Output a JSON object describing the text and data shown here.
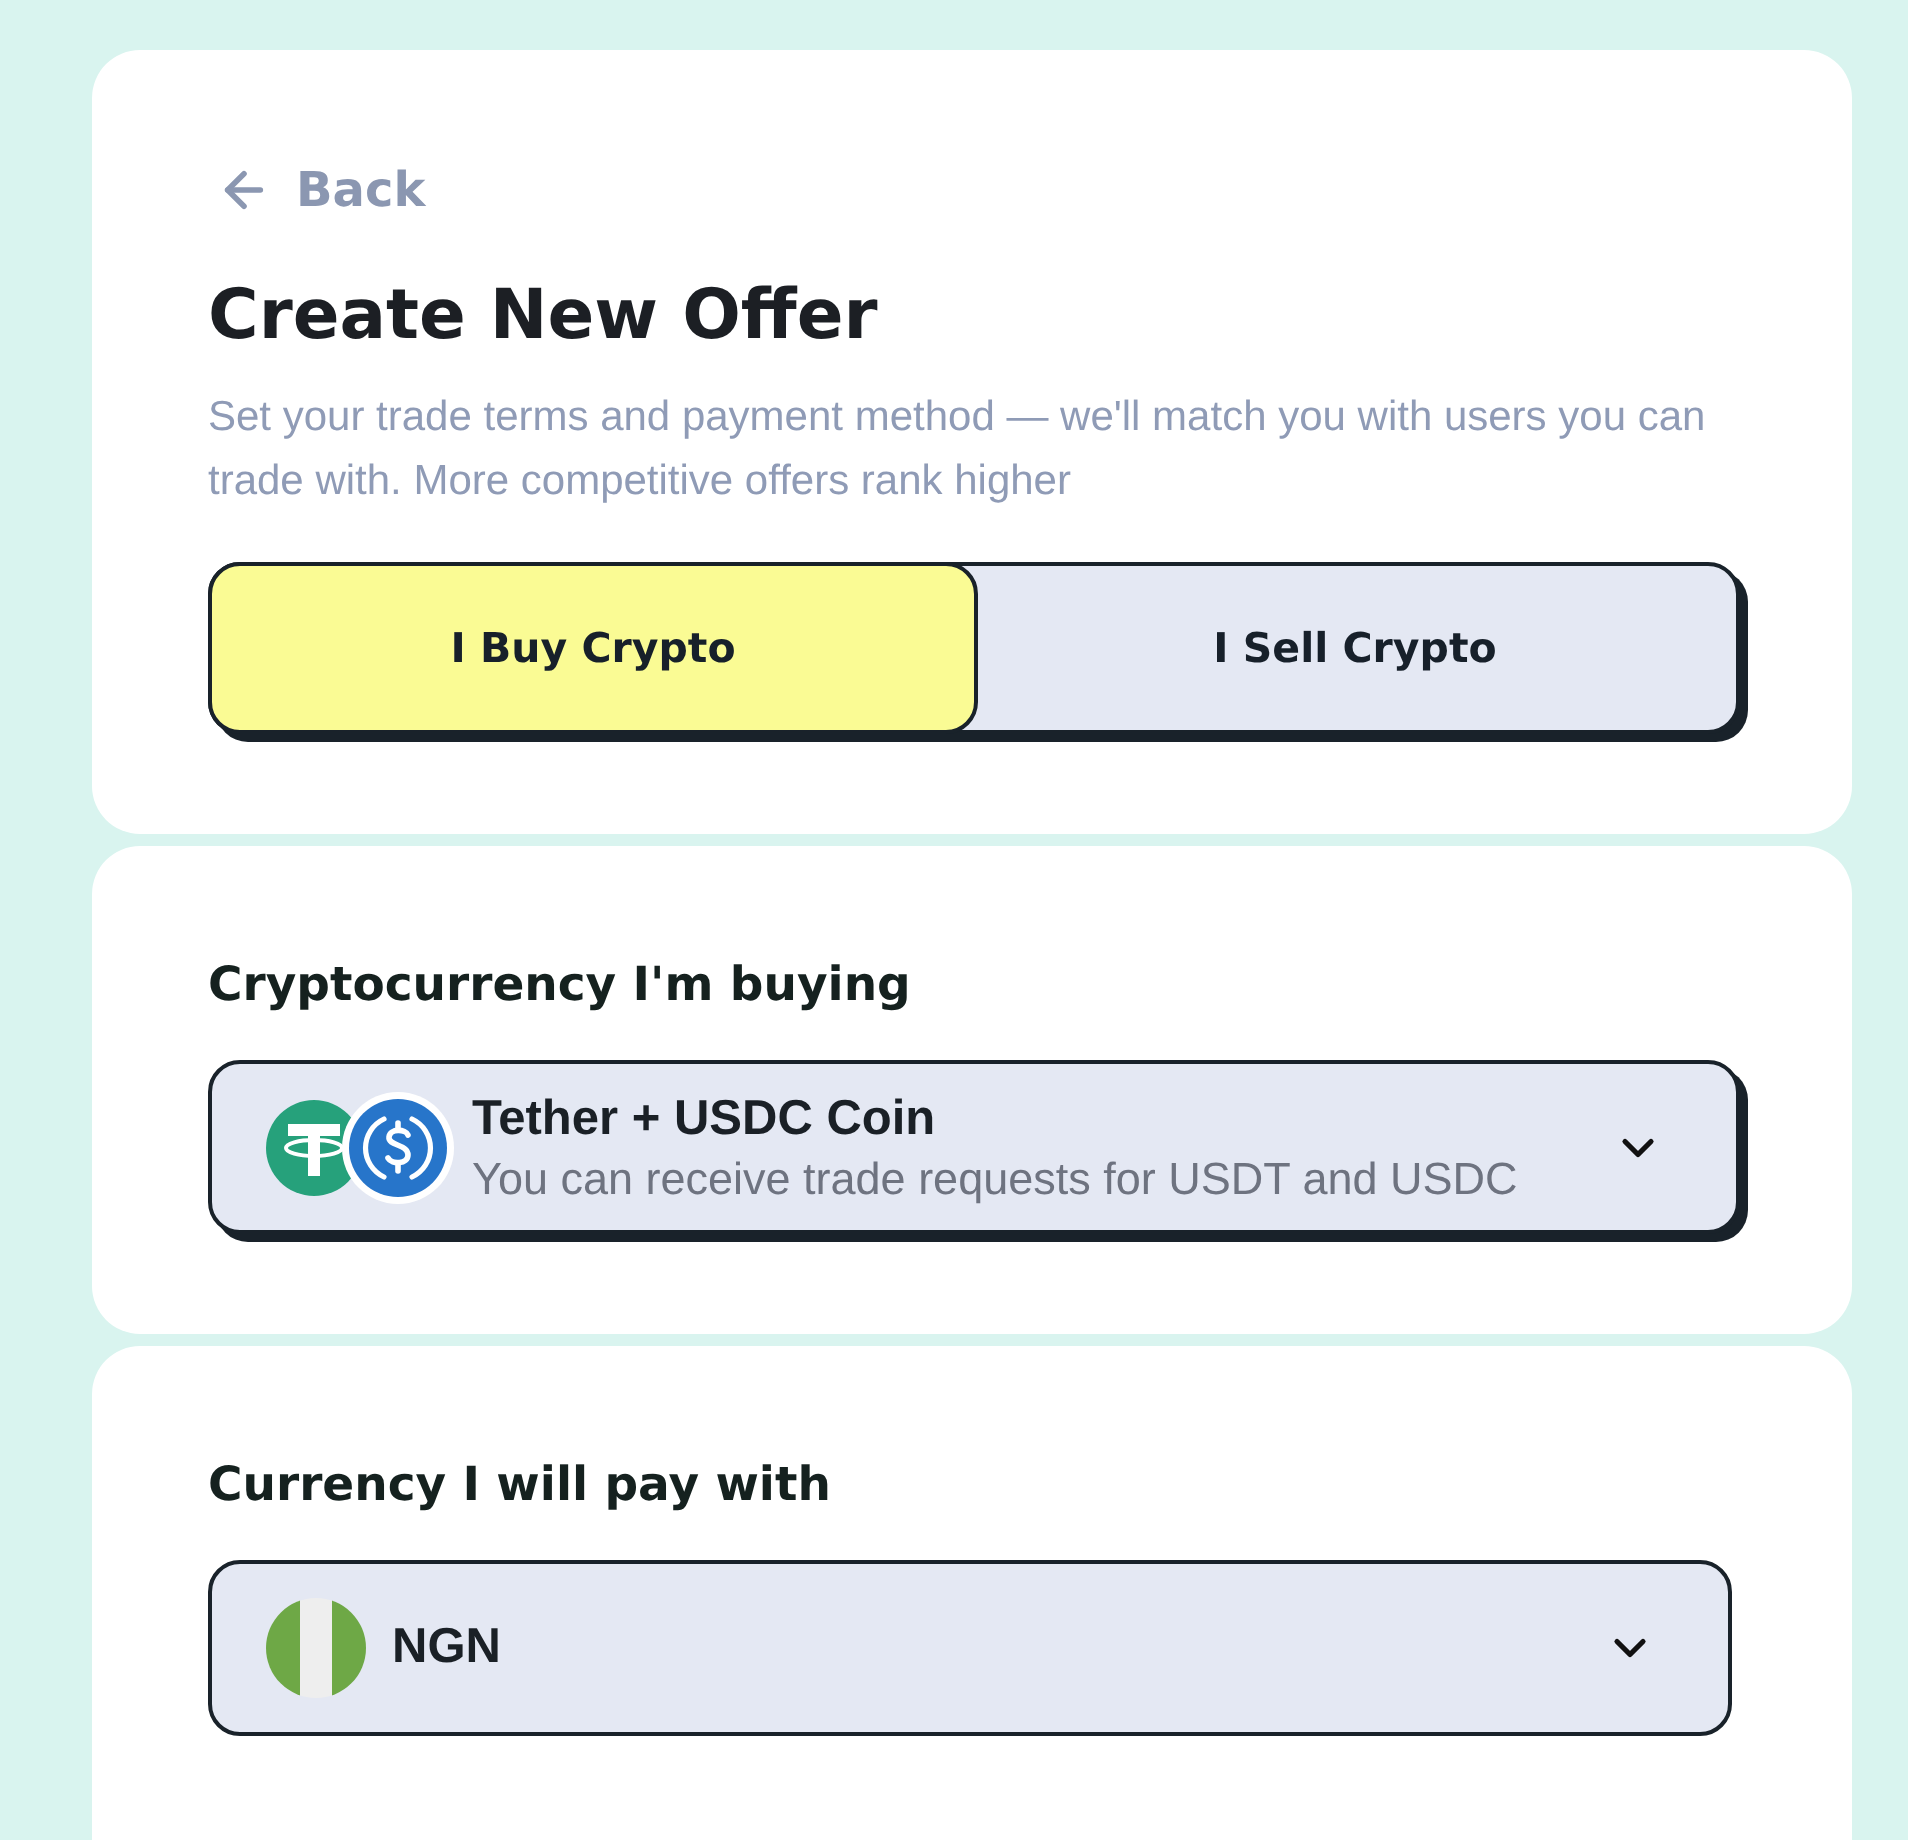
{
  "back_link": {
    "label": "Back"
  },
  "header": {
    "title": "Create New Offer",
    "subtitle": "Set your trade terms and payment method — we'll match you with users you can trade with. More competitive offers rank higher"
  },
  "trade_side_tabs": [
    {
      "label": "I Buy Crypto",
      "selected": true
    },
    {
      "label": "I Sell Crypto",
      "selected": false
    }
  ],
  "crypto_section": {
    "label": "Cryptocurrency I'm buying",
    "select": {
      "value": "Tether + USDC Coin",
      "description": "You can receive trade requests for USDT and USDC",
      "raised": true
    }
  },
  "currency_section": {
    "label": "Currency I will pay with",
    "select": {
      "value": "NGN",
      "raised": false
    }
  }
}
